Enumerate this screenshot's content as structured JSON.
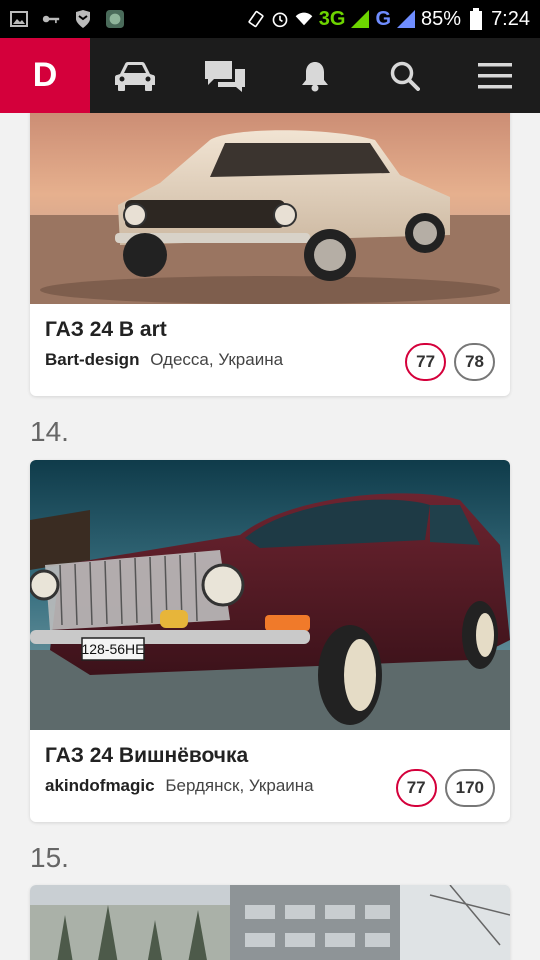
{
  "status_bar": {
    "network_3g": "3G",
    "network_g": "G",
    "battery": "85%",
    "time": "7:24"
  },
  "nav": {
    "logo_letter": "D",
    "icons": [
      "car-icon",
      "chat-icon",
      "bell-icon",
      "search-icon",
      "menu-icon"
    ]
  },
  "cards": [
    {
      "title": "ГАЗ 24 В art",
      "author": "Bart-design",
      "location": "Одесса, Украина",
      "badge_red": "77",
      "badge_grey": "78"
    },
    {
      "rank": "14.",
      "title": "ГАЗ 24 Вишнёвочка",
      "author": "akindofmagic",
      "location": "Бердянск, Украина",
      "badge_red": "77",
      "badge_grey": "170",
      "plate": "128-56НЕ"
    },
    {
      "rank": "15."
    }
  ],
  "colors": {
    "brand": "#d4003b",
    "nav_bg": "#1c1c1c",
    "page_bg": "#f2f2f2"
  }
}
